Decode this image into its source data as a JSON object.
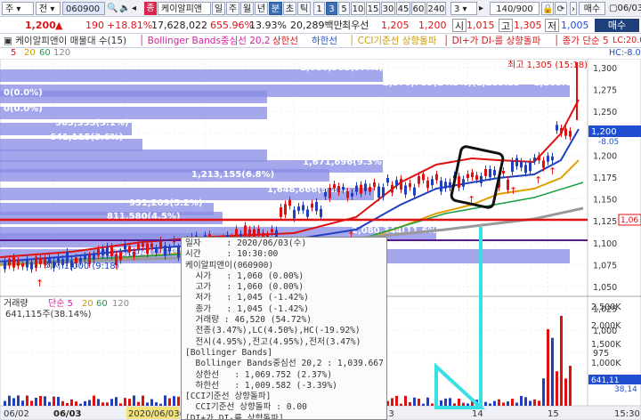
{
  "toolbar": {
    "market": "주",
    "compare": "전",
    "code": "060900",
    "name_chip": "케이알피앤",
    "tabs": [
      "일",
      "주",
      "월",
      "년",
      "분",
      "초",
      "틱"
    ],
    "active_tab": "분",
    "intervals": [
      "1",
      "3",
      "5",
      "10",
      "15",
      "30",
      "45",
      "60",
      "240"
    ],
    "active_interval": "3",
    "interval_select": "3",
    "counter": "140/900",
    "toggle_a": "매수",
    "toggle_b": "06/03"
  },
  "quote": {
    "price": "1,200",
    "arrow": "▲",
    "change": "190",
    "change_pct": "+18.81%",
    "volume": "17,628,022",
    "vol_ratio": "655.96%",
    "turnover_pct": "13.93%",
    "amount": "20,289백만",
    "ask_label": "최우선",
    "ask": "1,205",
    "bid": "1,200",
    "open_label": "시",
    "open": "1,015",
    "high_label": "고",
    "high": "1,305",
    "low_label": "저",
    "low": "1,005"
  },
  "legend": {
    "stock": "케이알피앤이 매물대 수(15)",
    "bb": "Bollinger Bands중심선 20,2",
    "bb_up": "상한선",
    "bb_dn": "하한선",
    "cci": "CCI기준선 상향돌파",
    "dmi": "DI+가 DI-를 상향돌파",
    "ma": "종가 단순 5",
    "lc": "LC:20.0",
    "hc": "HC:-8.0"
  },
  "periods": [
    "5",
    "20",
    "60",
    "120"
  ],
  "chart_data": {
    "type": "candlestick",
    "y_axis_labels": [
      "1,300",
      "1,275",
      "1,250",
      "1,225",
      "1,200",
      "1,175",
      "1,150",
      "1,125",
      "1,100",
      "1,075",
      "1,050",
      "1,025",
      "1,000",
      "975"
    ],
    "price_tag": "1,200",
    "price_tag_pct": "-8.05",
    "line_tag": "1,06",
    "high_annotation": "최고 1,305 (15:18)",
    "low_annotation": "최저 1,000 (9:18)",
    "volume_profile": [
      {
        "label": "1,680,965(9.4%)"
      },
      {
        "label": "2,570,785(14.3%)(1,285.33 ~ 1,265.67)"
      },
      {
        "label": "0(0.0%)"
      },
      {
        "label": "0(0.0%)"
      },
      {
        "label": "563,335(3.1%)"
      },
      {
        "label": "641,115(3.6%)"
      },
      {
        "label": "2,086,080(11.6%)"
      },
      {
        "label": "1,671,696(9.3%)"
      },
      {
        "label": "1,213,155(6.8%)"
      },
      {
        "label": "1,648,666(9.2%)"
      },
      {
        "label": "931,209(5.2%)"
      },
      {
        "label": "811,580(4.5%)"
      },
      {
        "label": "2,080,344(11.6%)"
      },
      {
        "label": "2,065,694(11.5%)"
      },
      {
        "label": "641,115주(38.14%)"
      }
    ],
    "volume_axis": [
      "2,500K",
      "2,000K",
      "1,500K",
      "1,000K",
      "500K"
    ],
    "volume_tag": "641,11",
    "volume_tag_pct": "38,14",
    "volume_legend": {
      "title": "거래량",
      "ma": "단순 5",
      "p1": "20",
      "p2": "60",
      "p3": "120"
    },
    "x_labels": [
      "06/02",
      "06/03",
      "2020/06/03(수)",
      "13",
      "14",
      "15",
      "15:30"
    ]
  },
  "tooltip": [
    "일자     : 2020/06/03(수)",
    "시간     : 10:30:00",
    "케이알피앤이(060900)",
    "  시가   : 1,060 (0.00%)",
    "  고가   : 1,060 (0.00%)",
    "  저가   : 1,045 (-1.42%)",
    "  종가   : 1,045 (-1.42%)",
    "  거래량 : 46,520 (54.72%)",
    "  전종(3.47%),LC(4.50%),HC(-19.92%)",
    "  전시(4.95%),전고(4.95%),전저(3.47%)",
    "[Bollinger Bands]",
    "  Bollinger Bands중심선 20,2 : 1,039.667 (-0.51%)",
    "  상한선   : 1,069.752 (2.37%)",
    "  하한선   : 1,009.582 (-3.39%)",
    "[CCI기준선 상향돌파]",
    "  CCI기준선 상향돌파 : 0.00",
    "[DI+가 DI-를 상향돌파]"
  ]
}
